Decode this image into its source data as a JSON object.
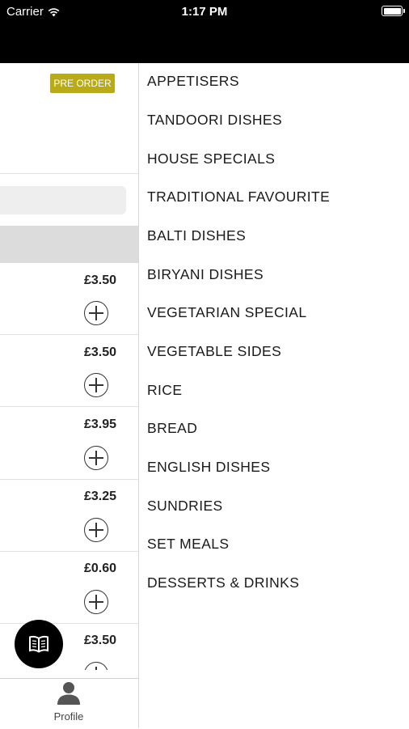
{
  "status_bar": {
    "carrier": "Carrier",
    "time": "1:17 PM"
  },
  "left_panel": {
    "preorder_label": "PRE ORDER",
    "items": [
      {
        "price": "£3.50"
      },
      {
        "price": "£3.50"
      },
      {
        "price": "£3.95"
      },
      {
        "price": "£3.25"
      },
      {
        "price": "£0.60"
      },
      {
        "price": "£3.50"
      }
    ]
  },
  "tab_bar": {
    "profile_label": "Profile"
  },
  "menu": {
    "items": [
      "APPETISERS",
      "TANDOORI DISHES",
      "HOUSE SPECIALS",
      "TRADITIONAL FAVOURITE",
      "BALTI DISHES",
      "BIRYANI DISHES",
      "VEGETARIAN SPECIAL",
      "VEGETABLE SIDES",
      "RICE",
      "BREAD",
      "ENGLISH DISHES",
      "SUNDRIES",
      "SET MEALS",
      "DESSERTS & DRINKS"
    ]
  },
  "colors": {
    "accent": "#b9aa18",
    "status_bar": "#000000"
  },
  "icons": [
    "wifi-icon",
    "battery-icon",
    "add-circle-icon",
    "menu-book-icon",
    "profile-icon"
  ]
}
